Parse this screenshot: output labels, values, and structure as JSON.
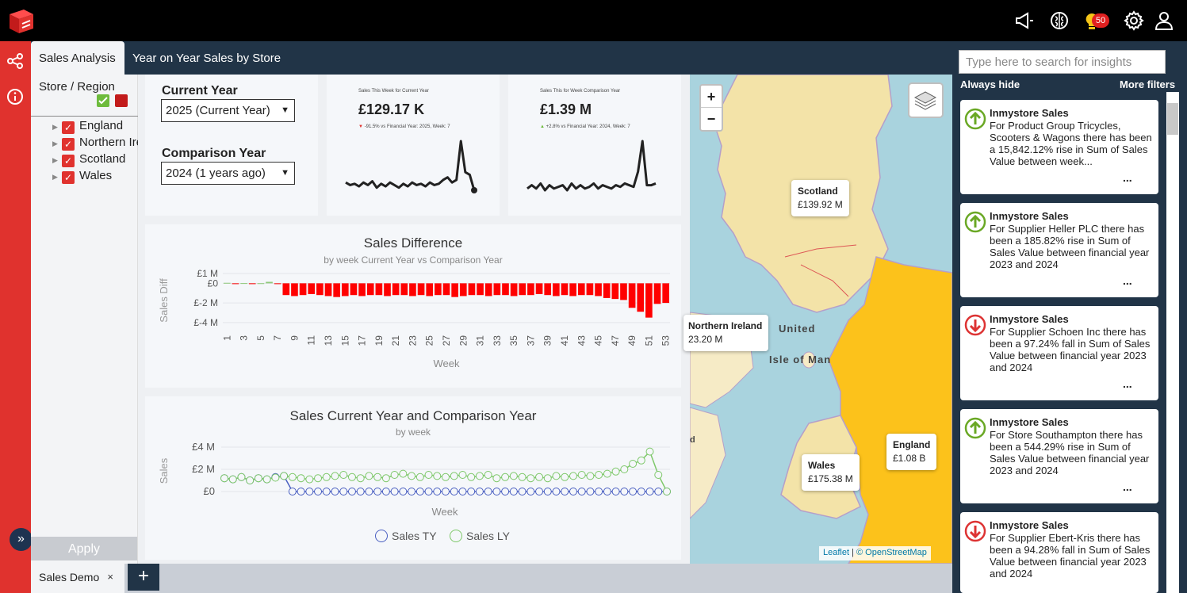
{
  "app": {
    "brand_color": "#e0322e",
    "dark_color": "#213447",
    "notifications_count": "50"
  },
  "topbar": {
    "icons": [
      "megaphone-icon",
      "brain-icon",
      "lightbulb-icon",
      "gear-icon",
      "user-icon"
    ]
  },
  "rail": {
    "icons": [
      "share-icon",
      "info-icon",
      "expand-icon"
    ]
  },
  "tabs": [
    {
      "label": "Sales Analysis",
      "active": true
    },
    {
      "label": "Year on Year Sales by Store",
      "active": false
    }
  ],
  "filters": {
    "title": "Store / Region",
    "items": [
      {
        "label": "England",
        "checked": true
      },
      {
        "label": "Northern Ireland",
        "checked": true
      },
      {
        "label": "Scotland",
        "checked": true
      },
      {
        "label": "Wales",
        "checked": true
      }
    ],
    "apply_label": "Apply"
  },
  "selectors": {
    "current_year_label": "Current Year",
    "current_year_value": "2025 (Current Year)",
    "comparison_year_label": "Comparison Year",
    "comparison_year_value": "2024 (1 years ago)"
  },
  "kpis": [
    {
      "caption": "Sales This Week for Current Year",
      "value": "£129.17 K",
      "change": "-91.5% vs Financial Year: 2025, Week: 7",
      "direction": "down"
    },
    {
      "caption": "Sales This for Week Comparison Year",
      "value": "£1.39 M",
      "change": "+2.8% vs Financial Year: 2024, Week: 7",
      "direction": "up"
    }
  ],
  "diff_chart": {
    "title": "Sales Difference",
    "subtitle": "by week Current Year vs Comparison Year",
    "ylabel": "Sales Diff",
    "xlabel": "Week",
    "yticks": [
      "£1 M",
      "£0",
      "£-2 M",
      "£-4 M"
    ],
    "xticks": [
      "1",
      "3",
      "5",
      "7",
      "9",
      "11",
      "13",
      "15",
      "17",
      "19",
      "21",
      "23",
      "25",
      "27",
      "29",
      "31",
      "33",
      "35",
      "37",
      "39",
      "41",
      "43",
      "45",
      "47",
      "49",
      "51",
      "53"
    ]
  },
  "line_chart": {
    "title": "Sales Current Year and Comparison Year",
    "subtitle": "by week",
    "ylabel": "Sales",
    "xlabel": "Week",
    "yticks": [
      "£4 M",
      "£2 M",
      "£0"
    ],
    "legend": [
      "Sales TY",
      "Sales LY"
    ]
  },
  "chart_data": [
    {
      "type": "line",
      "title": "",
      "series": [
        {
          "name": "",
          "values": [
            1.2,
            1.1,
            1.15,
            1.05,
            1.2,
            1.1,
            1.25,
            1.0,
            1.15,
            1.05,
            1.2,
            1.1,
            1.0,
            1.15,
            1.05,
            1.2,
            1.1,
            1.15,
            1.05,
            1.2,
            1.1,
            1.15,
            1.3,
            1.4,
            1.2,
            1.3,
            2.8,
            1.6,
            1.5,
            0.9
          ]
        }
      ]
    },
    {
      "type": "line",
      "title": "",
      "series": [
        {
          "name": "",
          "values": [
            1.1,
            1.2,
            1.1,
            1.25,
            1.05,
            1.2,
            1.1,
            1.15,
            1.2,
            1.05,
            1.25,
            1.1,
            1.2,
            1.1,
            1.15,
            1.25,
            1.1,
            1.2,
            1.15,
            1.1,
            1.2,
            1.15,
            1.25,
            1.2,
            1.15,
            1.6,
            2.5,
            1.2,
            1.2,
            1.25
          ]
        }
      ]
    },
    {
      "type": "bar",
      "title": "Sales Difference",
      "xlabel": "Week",
      "ylabel": "Sales Diff",
      "ylim": [
        -4.5,
        1
      ],
      "categories": [
        "1",
        "2",
        "3",
        "4",
        "5",
        "6",
        "7",
        "8",
        "9",
        "10",
        "11",
        "12",
        "13",
        "14",
        "15",
        "16",
        "17",
        "18",
        "19",
        "20",
        "21",
        "22",
        "23",
        "24",
        "25",
        "26",
        "27",
        "28",
        "29",
        "30",
        "31",
        "32",
        "33",
        "34",
        "35",
        "36",
        "37",
        "38",
        "39",
        "40",
        "41",
        "42",
        "43",
        "44",
        "45",
        "46",
        "47",
        "48",
        "49",
        "50",
        "51",
        "52",
        "53"
      ],
      "values": [
        0.05,
        -0.05,
        0.02,
        -0.03,
        0.01,
        0.15,
        -0.05,
        -1.2,
        -1.3,
        -1.2,
        -1.1,
        -1.2,
        -1.3,
        -1.4,
        -1.3,
        -1.2,
        -1.3,
        -1.2,
        -1.2,
        -1.3,
        -1.2,
        -1.2,
        -1.3,
        -1.2,
        -1.3,
        -1.2,
        -1.2,
        -1.4,
        -1.3,
        -1.2,
        -1.2,
        -1.3,
        -1.2,
        -1.2,
        -1.3,
        -1.2,
        -1.2,
        -1.1,
        -1.2,
        -1.3,
        -1.2,
        -1.3,
        -1.2,
        -1.2,
        -1.3,
        -1.5,
        -1.6,
        -1.7,
        -2.5,
        -2.9,
        -3.5,
        -2.1,
        -2.0
      ],
      "grid": true
    },
    {
      "type": "line",
      "title": "Sales Current Year and Comparison Year",
      "xlabel": "Week",
      "ylabel": "Sales",
      "ylim": [
        0,
        4
      ],
      "series": [
        {
          "name": "Sales TY",
          "color": "#4a5fc1",
          "values": [
            1.2,
            1.1,
            1.3,
            1.0,
            1.2,
            1.1,
            1.3,
            1.4,
            0,
            0,
            0,
            0,
            0,
            0,
            0,
            0,
            0,
            0,
            0,
            0,
            0,
            0,
            0,
            0,
            0,
            0,
            0,
            0,
            0,
            0,
            0,
            0,
            0,
            0,
            0,
            0,
            0,
            0,
            0,
            0,
            0,
            0,
            0,
            0,
            0,
            0,
            0,
            0,
            0,
            0,
            0,
            0,
            0
          ]
        },
        {
          "name": "Sales LY",
          "color": "#7ec86a",
          "values": [
            1.2,
            1.1,
            1.3,
            1.0,
            1.2,
            1.1,
            1.25,
            1.4,
            1.3,
            1.2,
            1.1,
            1.2,
            1.3,
            1.4,
            1.5,
            1.3,
            1.2,
            1.4,
            1.3,
            1.2,
            1.5,
            1.6,
            1.4,
            1.3,
            1.5,
            1.4,
            1.3,
            1.4,
            1.5,
            1.3,
            1.4,
            1.5,
            1.2,
            1.3,
            1.4,
            1.3,
            1.2,
            1.3,
            1.2,
            1.4,
            1.3,
            1.4,
            1.5,
            1.4,
            1.5,
            1.6,
            1.8,
            2.0,
            2.5,
            2.8,
            3.6,
            1.5,
            0
          ]
        }
      ],
      "grid": true
    }
  ],
  "map": {
    "zoom_in": "+",
    "zoom_out": "−",
    "labels": [
      {
        "region": "Scotland",
        "value": "£139.92 M"
      },
      {
        "region": "Northern Ireland",
        "value": "23.20 M"
      },
      {
        "region": "Wales",
        "value": "£175.38 M"
      },
      {
        "region": "England",
        "value": "£1.08 B"
      }
    ],
    "place_labels": [
      "United",
      "Isle of Man",
      "d"
    ],
    "attribution_leaflet": "Leaflet",
    "attribution_osm": "© OpenStreetMap"
  },
  "insights": {
    "search_placeholder": "Type here to search for insights",
    "always_hide": "Always hide",
    "more_filters": "More filters",
    "more_label": "...",
    "cards": [
      {
        "title": "Inmystore Sales",
        "text": "For Product Group Tricycles, Scooters & Wagons there has been a 15,842.12% rise in Sum of Sales Value between week...",
        "direction": "up"
      },
      {
        "title": "Inmystore Sales",
        "text": "For Supplier Heller PLC there has been a 185.82% rise in Sum of Sales Value between financial year 2023 and 2024",
        "direction": "up"
      },
      {
        "title": "Inmystore Sales",
        "text": "For Supplier Schoen Inc there has been a 97.24% fall in Sum of Sales Value between financial year 2023 and 2024",
        "direction": "down"
      },
      {
        "title": "Inmystore Sales",
        "text": "For Store Southampton there has been a 544.29% rise in Sum of Sales Value between financial year 2023 and 2024",
        "direction": "up"
      },
      {
        "title": "Inmystore Sales",
        "text": "For Supplier Ebert-Kris there has been a 94.28% fall in Sum of Sales Value between financial year 2023 and 2024",
        "direction": "down"
      }
    ]
  },
  "bottom_tabs": [
    {
      "label": "Sales Demo",
      "close": "×"
    }
  ],
  "add_tab_label": "+"
}
